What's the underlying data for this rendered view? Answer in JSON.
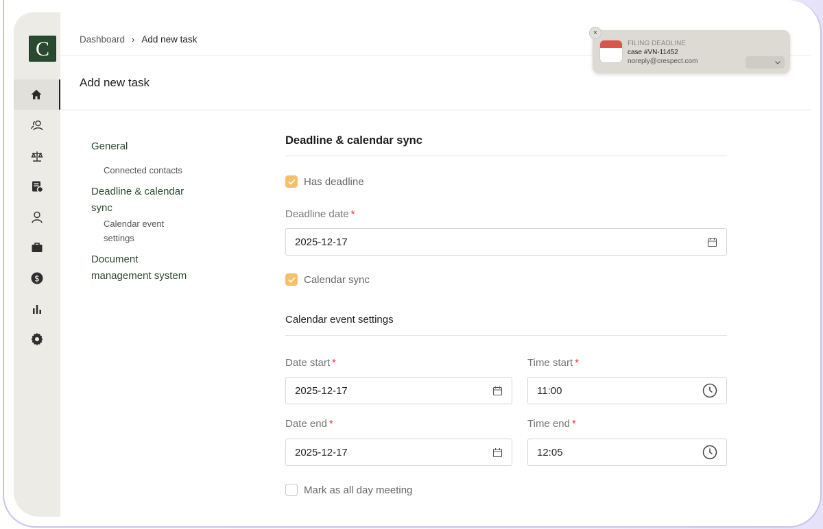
{
  "app": {
    "logo_letter": "C"
  },
  "sidebar": {
    "items": [
      {
        "icon": "home-icon",
        "active": true
      },
      {
        "icon": "contacts-icon"
      },
      {
        "icon": "scale-icon"
      },
      {
        "icon": "billing-document-icon"
      },
      {
        "icon": "user-icon"
      },
      {
        "icon": "briefcase-icon"
      },
      {
        "icon": "dollar-icon"
      },
      {
        "icon": "bar-chart-icon"
      },
      {
        "icon": "gear-icon"
      }
    ]
  },
  "breadcrumb": {
    "root": "Dashboard",
    "separator": "›",
    "current": "Add new task"
  },
  "header": {
    "title": "Add new task"
  },
  "toc": {
    "general": "General",
    "connected_contacts": "Connected contacts",
    "deadline_sync_line1": "Deadline & calendar",
    "deadline_sync_line2": "sync",
    "calendar_event_line1": "Calendar event",
    "calendar_event_line2": "settings",
    "dms_line1": "Document",
    "dms_line2": "management system"
  },
  "form": {
    "section_title": "Deadline & calendar sync",
    "has_deadline": {
      "label": "Has deadline",
      "checked": true
    },
    "deadline_date": {
      "label": "Deadline date",
      "required_mark": "*",
      "value": "2025-12-17"
    },
    "calendar_sync": {
      "label": "Calendar sync",
      "checked": true
    },
    "subsection_title": "Calendar event settings",
    "date_start": {
      "label": "Date start",
      "required_mark": "*",
      "value": "2025-12-17"
    },
    "time_start": {
      "label": "Time start",
      "required_mark": "*",
      "value": "11:00"
    },
    "date_end": {
      "label": "Date end",
      "required_mark": "*",
      "value": "2025-12-17"
    },
    "time_end": {
      "label": "Time end",
      "required_mark": "*",
      "value": "12:05"
    },
    "all_day": {
      "label": "Mark as all day meeting",
      "checked": false
    }
  },
  "notification": {
    "title": "FILING DEADLINE",
    "body": "case #VN-11452",
    "sender": "noreply@crespect.com",
    "close": "×"
  },
  "colors": {
    "brand": "#2a4a30",
    "accent_checkbox": "#f5c06a",
    "required": "#e03434"
  }
}
